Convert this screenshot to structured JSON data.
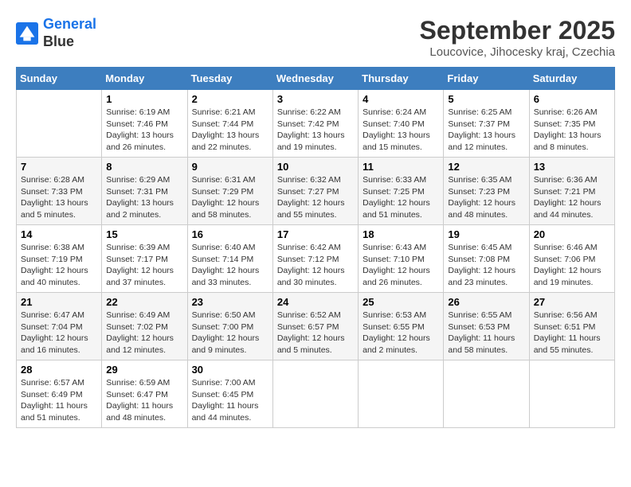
{
  "header": {
    "logo_line1": "General",
    "logo_line2": "Blue",
    "month": "September 2025",
    "location": "Loucovice, Jihocesky kraj, Czechia"
  },
  "days_of_week": [
    "Sunday",
    "Monday",
    "Tuesday",
    "Wednesday",
    "Thursday",
    "Friday",
    "Saturday"
  ],
  "weeks": [
    [
      {
        "num": "",
        "info": ""
      },
      {
        "num": "1",
        "info": "Sunrise: 6:19 AM\nSunset: 7:46 PM\nDaylight: 13 hours\nand 26 minutes."
      },
      {
        "num": "2",
        "info": "Sunrise: 6:21 AM\nSunset: 7:44 PM\nDaylight: 13 hours\nand 22 minutes."
      },
      {
        "num": "3",
        "info": "Sunrise: 6:22 AM\nSunset: 7:42 PM\nDaylight: 13 hours\nand 19 minutes."
      },
      {
        "num": "4",
        "info": "Sunrise: 6:24 AM\nSunset: 7:40 PM\nDaylight: 13 hours\nand 15 minutes."
      },
      {
        "num": "5",
        "info": "Sunrise: 6:25 AM\nSunset: 7:37 PM\nDaylight: 13 hours\nand 12 minutes."
      },
      {
        "num": "6",
        "info": "Sunrise: 6:26 AM\nSunset: 7:35 PM\nDaylight: 13 hours\nand 8 minutes."
      }
    ],
    [
      {
        "num": "7",
        "info": "Sunrise: 6:28 AM\nSunset: 7:33 PM\nDaylight: 13 hours\nand 5 minutes."
      },
      {
        "num": "8",
        "info": "Sunrise: 6:29 AM\nSunset: 7:31 PM\nDaylight: 13 hours\nand 2 minutes."
      },
      {
        "num": "9",
        "info": "Sunrise: 6:31 AM\nSunset: 7:29 PM\nDaylight: 12 hours\nand 58 minutes."
      },
      {
        "num": "10",
        "info": "Sunrise: 6:32 AM\nSunset: 7:27 PM\nDaylight: 12 hours\nand 55 minutes."
      },
      {
        "num": "11",
        "info": "Sunrise: 6:33 AM\nSunset: 7:25 PM\nDaylight: 12 hours\nand 51 minutes."
      },
      {
        "num": "12",
        "info": "Sunrise: 6:35 AM\nSunset: 7:23 PM\nDaylight: 12 hours\nand 48 minutes."
      },
      {
        "num": "13",
        "info": "Sunrise: 6:36 AM\nSunset: 7:21 PM\nDaylight: 12 hours\nand 44 minutes."
      }
    ],
    [
      {
        "num": "14",
        "info": "Sunrise: 6:38 AM\nSunset: 7:19 PM\nDaylight: 12 hours\nand 40 minutes."
      },
      {
        "num": "15",
        "info": "Sunrise: 6:39 AM\nSunset: 7:17 PM\nDaylight: 12 hours\nand 37 minutes."
      },
      {
        "num": "16",
        "info": "Sunrise: 6:40 AM\nSunset: 7:14 PM\nDaylight: 12 hours\nand 33 minutes."
      },
      {
        "num": "17",
        "info": "Sunrise: 6:42 AM\nSunset: 7:12 PM\nDaylight: 12 hours\nand 30 minutes."
      },
      {
        "num": "18",
        "info": "Sunrise: 6:43 AM\nSunset: 7:10 PM\nDaylight: 12 hours\nand 26 minutes."
      },
      {
        "num": "19",
        "info": "Sunrise: 6:45 AM\nSunset: 7:08 PM\nDaylight: 12 hours\nand 23 minutes."
      },
      {
        "num": "20",
        "info": "Sunrise: 6:46 AM\nSunset: 7:06 PM\nDaylight: 12 hours\nand 19 minutes."
      }
    ],
    [
      {
        "num": "21",
        "info": "Sunrise: 6:47 AM\nSunset: 7:04 PM\nDaylight: 12 hours\nand 16 minutes."
      },
      {
        "num": "22",
        "info": "Sunrise: 6:49 AM\nSunset: 7:02 PM\nDaylight: 12 hours\nand 12 minutes."
      },
      {
        "num": "23",
        "info": "Sunrise: 6:50 AM\nSunset: 7:00 PM\nDaylight: 12 hours\nand 9 minutes."
      },
      {
        "num": "24",
        "info": "Sunrise: 6:52 AM\nSunset: 6:57 PM\nDaylight: 12 hours\nand 5 minutes."
      },
      {
        "num": "25",
        "info": "Sunrise: 6:53 AM\nSunset: 6:55 PM\nDaylight: 12 hours\nand 2 minutes."
      },
      {
        "num": "26",
        "info": "Sunrise: 6:55 AM\nSunset: 6:53 PM\nDaylight: 11 hours\nand 58 minutes."
      },
      {
        "num": "27",
        "info": "Sunrise: 6:56 AM\nSunset: 6:51 PM\nDaylight: 11 hours\nand 55 minutes."
      }
    ],
    [
      {
        "num": "28",
        "info": "Sunrise: 6:57 AM\nSunset: 6:49 PM\nDaylight: 11 hours\nand 51 minutes."
      },
      {
        "num": "29",
        "info": "Sunrise: 6:59 AM\nSunset: 6:47 PM\nDaylight: 11 hours\nand 48 minutes."
      },
      {
        "num": "30",
        "info": "Sunrise: 7:00 AM\nSunset: 6:45 PM\nDaylight: 11 hours\nand 44 minutes."
      },
      {
        "num": "",
        "info": ""
      },
      {
        "num": "",
        "info": ""
      },
      {
        "num": "",
        "info": ""
      },
      {
        "num": "",
        "info": ""
      }
    ]
  ]
}
